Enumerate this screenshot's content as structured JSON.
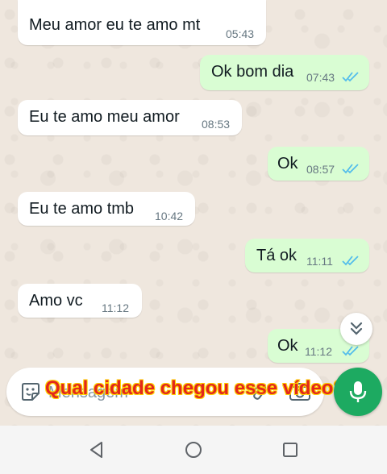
{
  "messages": [
    {
      "text": "Meu amor eu te amo mt",
      "time": "05:43",
      "dir": "in"
    },
    {
      "text": "Ok bom dia",
      "time": "07:43",
      "dir": "out"
    },
    {
      "text": "Eu te amo meu amor",
      "time": "08:53",
      "dir": "in"
    },
    {
      "text": "Ok",
      "time": "08:57",
      "dir": "out"
    },
    {
      "text": "Eu te amo tmb",
      "time": "10:42",
      "dir": "in"
    },
    {
      "text": "Tá ok",
      "time": "11:11",
      "dir": "out"
    },
    {
      "text": "Amo vc",
      "time": "11:12",
      "dir": "in"
    },
    {
      "text": "Ok",
      "time": "11:12",
      "dir": "out"
    }
  ],
  "input": {
    "placeholder": "Mensagem"
  },
  "overlay": {
    "caption": "Qual cidade chegou esse vídeo?"
  },
  "icons": {
    "read_receipt": "double-check-icon",
    "scroll_down": "chevrons-down-icon",
    "sticker": "sticker-icon",
    "attach": "paperclip-icon",
    "camera": "camera-icon",
    "mic": "mic-icon",
    "nav_back": "back-triangle-icon",
    "nav_home": "home-circle-icon",
    "nav_recents": "recents-square-icon"
  },
  "colors": {
    "chat_bg": "#efe7de",
    "incoming_bubble": "#ffffff",
    "outgoing_bubble": "#d9fdd3",
    "read_tick": "#53bdeb",
    "mic_button": "#1daa61",
    "caption_text": "#e2271d",
    "caption_outline": "#ffd200"
  }
}
